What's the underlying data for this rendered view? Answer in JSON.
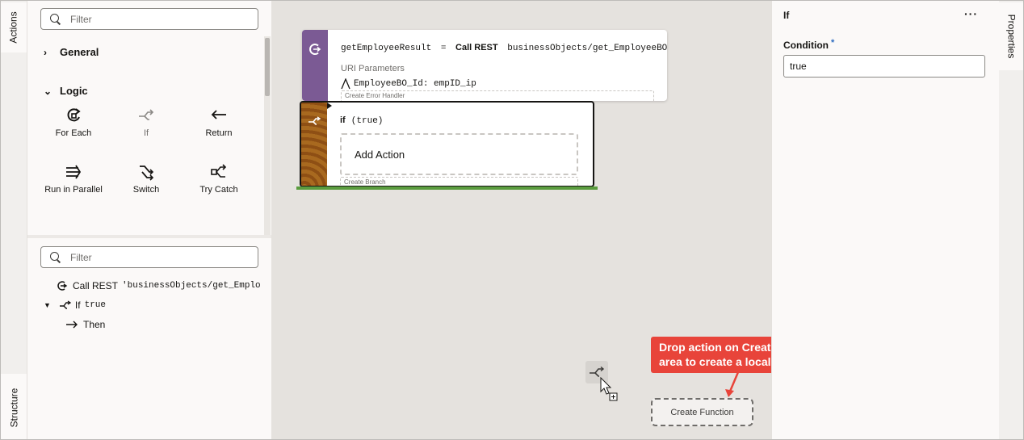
{
  "left_rail": {
    "actions_tab": "Actions",
    "structure_tab": "Structure"
  },
  "actions_panel": {
    "filter_placeholder": "Filter",
    "sections": [
      {
        "label": "General",
        "expanded": false
      },
      {
        "label": "Logic",
        "expanded": true
      }
    ],
    "items": [
      {
        "label": "For Each",
        "icon": "for-each-icon"
      },
      {
        "label": "If",
        "icon": "if-icon"
      },
      {
        "label": "Return",
        "icon": "return-icon"
      },
      {
        "label": "Run in Parallel",
        "icon": "run-in-parallel-icon"
      },
      {
        "label": "Switch",
        "icon": "switch-icon"
      },
      {
        "label": "Try Catch",
        "icon": "try-catch-icon"
      }
    ]
  },
  "structure_panel": {
    "filter_placeholder": "Filter",
    "tree": [
      {
        "label": "Call REST",
        "detail": "'businessObjects/get_Emplo"
      },
      {
        "label": "If",
        "detail": "true"
      },
      {
        "label": "Then"
      }
    ]
  },
  "canvas": {
    "rest_card": {
      "result": "getEmployeeResult",
      "equals": "=",
      "action": "Call REST",
      "endpoint": "businessObjects/get_EmployeeBO",
      "uri_label": "URI Parameters",
      "param": "EmployeeBO_Id: empID_ip",
      "error_handler": "Create Error Handler"
    },
    "if_card": {
      "keyword": "if",
      "condition": "(true)",
      "add_action": "Add Action",
      "create_branch": "Create Branch"
    },
    "callout": {
      "line1": "Drop action on Create Function",
      "line2": "area to create a local function"
    },
    "create_function": "Create Function"
  },
  "properties": {
    "tab": "Properties",
    "title": "If",
    "more": "···",
    "condition_label": "Condition",
    "required_marker": "*",
    "condition_value": "true"
  },
  "colors": {
    "rest_band": "#7b5a94",
    "if_band": "#9a5a1c",
    "drop_indicator": "#5a9c3e",
    "callout": "#e8443a",
    "canvas": "#e5e2de"
  }
}
